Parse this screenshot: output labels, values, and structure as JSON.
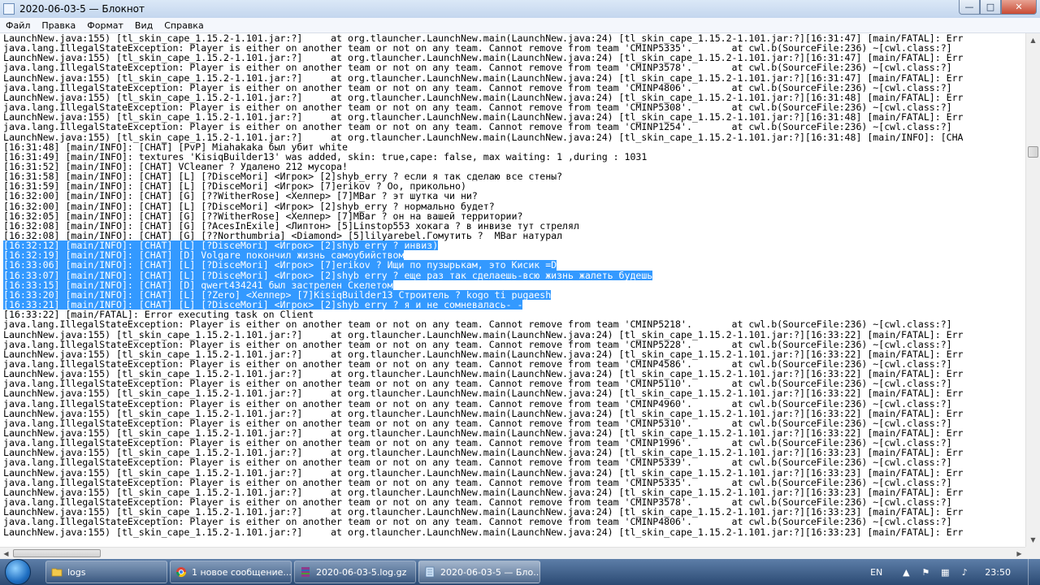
{
  "window": {
    "title": "2020-06-03-5 — Блокнот",
    "controls": {
      "minimize": "—",
      "maximize": "□",
      "close": "✕"
    }
  },
  "menu": [
    "Файл",
    "Правка",
    "Формат",
    "Вид",
    "Справка"
  ],
  "editor": {
    "lines": [
      "LaunchNew.java:155) [tl_skin_cape_1.15.2-1.101.jar:?]     at org.tlauncher.LaunchNew.main(LaunchNew.java:24) [tl_skin_cape_1.15.2-1.101.jar:?][16:31:47] [main/FATAL]: Err",
      "java.lang.IllegalStateException: Player is either on another team or not on any team. Cannot remove from team 'CMINP5335'.       at cwl.b(SourceFile:236) ~[cwl.class:?]",
      "LaunchNew.java:155) [tl_skin_cape_1.15.2-1.101.jar:?]     at org.tlauncher.LaunchNew.main(LaunchNew.java:24) [tl_skin_cape_1.15.2-1.101.jar:?][16:31:47] [main/FATAL]: Err",
      "java.lang.IllegalStateException: Player is either on another team or not on any team. Cannot remove from team 'CMINP3578'.       at cwl.b(SourceFile:236) ~[cwl.class:?]",
      "LaunchNew.java:155) [tl_skin_cape_1.15.2-1.101.jar:?]     at org.tlauncher.LaunchNew.main(LaunchNew.java:24) [tl_skin_cape_1.15.2-1.101.jar:?][16:31:47] [main/FATAL]: Err",
      "java.lang.IllegalStateException: Player is either on another team or not on any team. Cannot remove from team 'CMINP4806'.       at cwl.b(SourceFile:236) ~[cwl.class:?]",
      "LaunchNew.java:155) [tl_skin_cape_1.15.2-1.101.jar:?]     at org.tlauncher.LaunchNew.main(LaunchNew.java:24) [tl_skin_cape_1.15.2-1.101.jar:?][16:31:48] [main/FATAL]: Err",
      "java.lang.IllegalStateException: Player is either on another team or not on any team. Cannot remove from team 'CMINP5308'.       at cwl.b(SourceFile:236) ~[cwl.class:?]",
      "LaunchNew.java:155) [tl_skin_cape_1.15.2-1.101.jar:?]     at org.tlauncher.LaunchNew.main(LaunchNew.java:24) [tl_skin_cape_1.15.2-1.101.jar:?][16:31:48] [main/FATAL]: Err",
      "java.lang.IllegalStateException: Player is either on another team or not on any team. Cannot remove from team 'CMINP1254'.       at cwl.b(SourceFile:236) ~[cwl.class:?]",
      "LaunchNew.java:155) [tl_skin_cape_1.15.2-1.101.jar:?]     at org.tlauncher.LaunchNew.main(LaunchNew.java:24) [tl_skin_cape_1.15.2-1.101.jar:?][16:31:48] [main/INFO]: [CHA",
      "[16:31:48] [main/INFO]: [CHAT] [PvP] Miahakaka был убит white",
      "[16:31:49] [main/INFO]: textures 'KisiqBuilder13' was added, skin: true,cape: false, max waiting: 1 ,during : 1031",
      "[16:31:52] [main/INFO]: [CHAT] VCleaner ? Удалено 212 мусора!",
      "[16:31:58] [main/INFO]: [CHAT] [L] [?DisceMori] <Игрок> [2]shyb_erry ? если я так сделаю все стены?",
      "[16:31:59] [main/INFO]: [CHAT] [L] [?DisceMori] <Игрок> [7]erikov ? Оо, прикольно)",
      "[16:32:00] [main/INFO]: [CHAT] [G] [??WitherRose] <Хелпер> [7]MBar ? эт шутка чи ни?",
      "[16:32:00] [main/INFO]: [CHAT] [L] [?DisceMori] <Игрок> [2]shyb_erry ? нормально будет?",
      "[16:32:05] [main/INFO]: [CHAT] [G] [??WitherRose] <Хелпер> [7]MBar ? он на вашей территории?",
      "[16:32:08] [main/INFO]: [CHAT] [G] [?AcesInExile] <Липтон> [5]Linstop553 хокага ? в инвизе тут стрелял",
      "[16:32:08] [main/INFO]: [CHAT] [G] [??Northumbria] <Diamond> [5]lilyarebel.Гомутить ?  MBar натурал",
      "[16:32:12] [main/INFO]: [CHAT] [L] [?DisceMori] <Игрок> [2]shyb_erry ? инвиз)",
      "[16:32:19] [main/INFO]: [CHAT] [D] Volgare покончил жизнь самоубийством",
      "[16:33:06] [main/INFO]: [CHAT] [L] [?DisceMori] <Игрок> [7]erikov ? Ищи по пузырькам, это Кисик =D",
      "[16:33:07] [main/INFO]: [CHAT] [L] [?DisceMori] <Игрок> [2]shyb_erry ? еще раз так сделаешь-всю жизнь жалеть будешь",
      "[16:33:15] [main/INFO]: [CHAT] [D] qwert434241 был застрелен Скелетом",
      "[16:33:20] [main/INFO]: [CHAT] [L] [?Zero] <Хелпер> [7]KisiqBuilder13 Строитель ? kogo ti pugaesh",
      "[16:33:21] [main/INFO]: [CHAT] [L] [?DisceMori] <Игрок> [2]shyb_erry ? я и не сомневалась-_-",
      "[16:33:22] [main/FATAL]: Error executing task on Client",
      "java.lang.IllegalStateException: Player is either on another team or not on any team. Cannot remove from team 'CMINP5218'.       at cwl.b(SourceFile:236) ~[cwl.class:?]",
      "LaunchNew.java:155) [tl_skin_cape_1.15.2-1.101.jar:?]     at org.tlauncher.LaunchNew.main(LaunchNew.java:24) [tl_skin_cape_1.15.2-1.101.jar:?][16:33:22] [main/FATAL]: Err",
      "java.lang.IllegalStateException: Player is either on another team or not on any team. Cannot remove from team 'CMINP5228'.       at cwl.b(SourceFile:236) ~[cwl.class:?]",
      "LaunchNew.java:155) [tl_skin_cape_1.15.2-1.101.jar:?]     at org.tlauncher.LaunchNew.main(LaunchNew.java:24) [tl_skin_cape_1.15.2-1.101.jar:?][16:33:22] [main/FATAL]: Err",
      "java.lang.IllegalStateException: Player is either on another team or not on any team. Cannot remove from team 'CMINP4586'.       at cwl.b(SourceFile:236) ~[cwl.class:?]",
      "LaunchNew.java:155) [tl_skin_cape_1.15.2-1.101.jar:?]     at org.tlauncher.LaunchNew.main(LaunchNew.java:24) [tl_skin_cape_1.15.2-1.101.jar:?][16:33:22] [main/FATAL]: Err",
      "java.lang.IllegalStateException: Player is either on another team or not on any team. Cannot remove from team 'CMINP5110'.       at cwl.b(SourceFile:236) ~[cwl.class:?]",
      "LaunchNew.java:155) [tl_skin_cape_1.15.2-1.101.jar:?]     at org.tlauncher.LaunchNew.main(LaunchNew.java:24) [tl_skin_cape_1.15.2-1.101.jar:?][16:33:22] [main/FATAL]: Err",
      "java.lang.IllegalStateException: Player is either on another team or not on any team. Cannot remove from team 'CMINP4960'.       at cwl.b(SourceFile:236) ~[cwl.class:?]",
      "LaunchNew.java:155) [tl_skin_cape_1.15.2-1.101.jar:?]     at org.tlauncher.LaunchNew.main(LaunchNew.java:24) [tl_skin_cape_1.15.2-1.101.jar:?][16:33:22] [main/FATAL]: Err",
      "java.lang.IllegalStateException: Player is either on another team or not on any team. Cannot remove from team 'CMINP5310'.       at cwl.b(SourceFile:236) ~[cwl.class:?]",
      "LaunchNew.java:155) [tl_skin_cape_1.15.2-1.101.jar:?]     at org.tlauncher.LaunchNew.main(LaunchNew.java:24) [tl_skin_cape_1.15.2-1.101.jar:?][16:33:22] [main/FATAL]: Err",
      "java.lang.IllegalStateException: Player is either on another team or not on any team. Cannot remove from team 'CMINP1996'.       at cwl.b(SourceFile:236) ~[cwl.class:?]",
      "LaunchNew.java:155) [tl_skin_cape_1.15.2-1.101.jar:?]     at org.tlauncher.LaunchNew.main(LaunchNew.java:24) [tl_skin_cape_1.15.2-1.101.jar:?][16:33:23] [main/FATAL]: Err",
      "java.lang.IllegalStateException: Player is either on another team or not on any team. Cannot remove from team 'CMINP5339'.       at cwl.b(SourceFile:236) ~[cwl.class:?]",
      "LaunchNew.java:155) [tl_skin_cape_1.15.2-1.101.jar:?]     at org.tlauncher.LaunchNew.main(LaunchNew.java:24) [tl_skin_cape_1.15.2-1.101.jar:?][16:33:23] [main/FATAL]: Err",
      "java.lang.IllegalStateException: Player is either on another team or not on any team. Cannot remove from team 'CMINP5335'.       at cwl.b(SourceFile:236) ~[cwl.class:?]",
      "LaunchNew.java:155) [tl_skin_cape_1.15.2-1.101.jar:?]     at org.tlauncher.LaunchNew.main(LaunchNew.java:24) [tl_skin_cape_1.15.2-1.101.jar:?][16:33:23] [main/FATAL]: Err",
      "java.lang.IllegalStateException: Player is either on another team or not on any team. Cannot remove from team 'CMINP3578'.       at cwl.b(SourceFile:236) ~[cwl.class:?]",
      "LaunchNew.java:155) [tl_skin_cape_1.15.2-1.101.jar:?]     at org.tlauncher.LaunchNew.main(LaunchNew.java:24) [tl_skin_cape_1.15.2-1.101.jar:?][16:33:23] [main/FATAL]: Err",
      "java.lang.IllegalStateException: Player is either on another team or not on any team. Cannot remove from team 'CMINP4806'.       at cwl.b(SourceFile:236) ~[cwl.class:?]",
      "LaunchNew.java:155) [tl_skin_cape_1.15.2-1.101.jar:?]     at org.tlauncher.LaunchNew.main(LaunchNew.java:24) [tl_skin_cape_1.15.2-1.101.jar:?][16:33:23] [main/FATAL]: Err"
    ],
    "selected_lines": [
      21,
      22,
      23,
      24,
      25,
      26,
      27
    ]
  },
  "taskbar": {
    "tasks": [
      {
        "label": "logs",
        "icon": "folder-icon",
        "color": "#f2c94c"
      },
      {
        "label": "1 новое сообщение...",
        "icon": "chrome-icon",
        "color": "#db4437"
      },
      {
        "label": "2020-06-03-5.log.gz",
        "icon": "winrar-icon",
        "color": "#8e3b8a"
      },
      {
        "label": "2020-06-03-5 — Бло...",
        "icon": "notepad-icon",
        "color": "#cfe3f7"
      }
    ],
    "language": "EN",
    "clock": "23:50"
  },
  "colors": {
    "selection": "#3399ff",
    "taskbar": "#2b4a73"
  }
}
